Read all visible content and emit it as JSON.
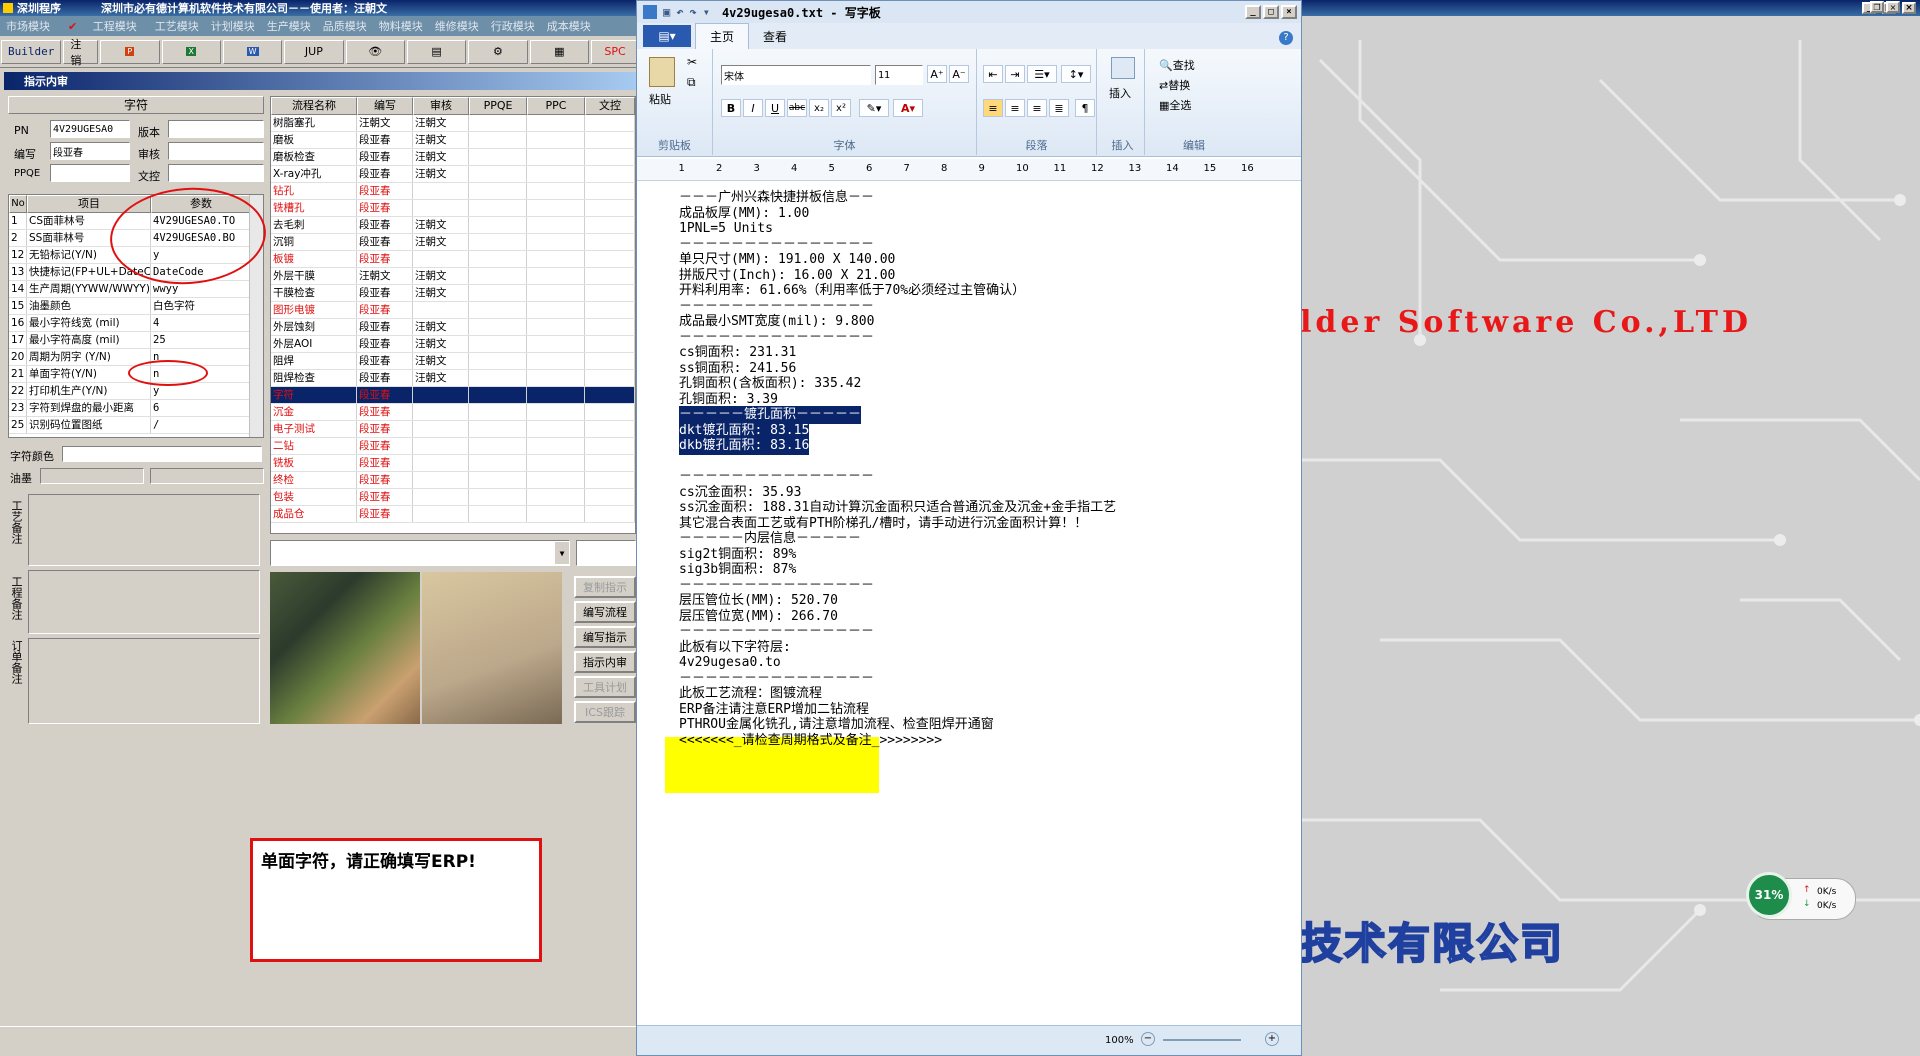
{
  "erp": {
    "title": "深圳程序",
    "company_user": "深圳市必有德计算机软件技术有限公司－－使用者：汪朝文",
    "menu": [
      "市场模块",
      "工程模块",
      "工艺模块",
      "计划模块",
      "生产模块",
      "品质模块",
      "物料模块",
      "维修模块",
      "行政模块",
      "成本模块"
    ],
    "toolbar": [
      "Builder",
      "注销",
      "",
      "",
      "",
      "JUP",
      "",
      "",
      "",
      "",
      "SPC"
    ],
    "form_title": "指示内审",
    "section_header": "字符",
    "fields": {
      "pn_label": "PN",
      "pn_value": "4V29UGESA0",
      "version_label": "版本",
      "version_value": "",
      "author_label": "编写",
      "author_value": "段亚春",
      "review_label": "审核",
      "review_value": "",
      "ppqe_label": "PPQE",
      "ppqe_value": "",
      "control_label": "文控",
      "control_value": ""
    },
    "params_headers": [
      "No",
      "项目",
      "参数"
    ],
    "params": [
      {
        "no": "1",
        "item": "CS面菲林号",
        "value": "4V29UGESA0.TO"
      },
      {
        "no": "2",
        "item": "SS面菲林号",
        "value": "4V29UGESA0.BO"
      },
      {
        "no": "12",
        "item": "无铅标记(Y/N)",
        "value": "y"
      },
      {
        "no": "13",
        "item": "快捷标记(FP+UL+DateCo",
        "value": "DateCode"
      },
      {
        "no": "14",
        "item": "生产周期(YYWW/WWYY)",
        "value": "wwyy"
      },
      {
        "no": "15",
        "item": "油墨颜色",
        "value": "白色字符"
      },
      {
        "no": "16",
        "item": "最小字符线宽 (mil)",
        "value": "4"
      },
      {
        "no": "17",
        "item": "最小字符高度 (mil)",
        "value": "25"
      },
      {
        "no": "20",
        "item": "周期为阴字 (Y/N)",
        "value": "n"
      },
      {
        "no": "21",
        "item": "单面字符(Y/N)",
        "value": "n"
      },
      {
        "no": "22",
        "item": "打印机生产(Y/N)",
        "value": "y"
      },
      {
        "no": "23",
        "item": "字符到焊盘的最小距离",
        "value": "6"
      },
      {
        "no": "25",
        "item": "识别码位置图纸",
        "value": "/"
      }
    ],
    "char_color_label": "字符颜色",
    "ink_label": "油墨",
    "side_labels": [
      "工艺备注",
      "工程备注",
      "订单备注"
    ],
    "flow_headers": [
      "流程名称",
      "编写",
      "审核",
      "PPQE",
      "PPC",
      "文控"
    ],
    "flow": [
      {
        "name": "树脂塞孔",
        "author": "汪朝文",
        "reviewer": "汪朝文",
        "red": false
      },
      {
        "name": "磨板",
        "author": "段亚春",
        "reviewer": "汪朝文",
        "red": false
      },
      {
        "name": "磨板检查",
        "author": "段亚春",
        "reviewer": "汪朝文",
        "red": false
      },
      {
        "name": "X-ray冲孔",
        "author": "段亚春",
        "reviewer": "汪朝文",
        "red": false
      },
      {
        "name": "钻孔",
        "author": "段亚春",
        "reviewer": "",
        "red": true
      },
      {
        "name": "铣槽孔",
        "author": "段亚春",
        "reviewer": "",
        "red": true
      },
      {
        "name": "去毛刺",
        "author": "段亚春",
        "reviewer": "汪朝文",
        "red": false
      },
      {
        "name": "沉铜",
        "author": "段亚春",
        "reviewer": "汪朝文",
        "red": false
      },
      {
        "name": "板镀",
        "author": "段亚春",
        "reviewer": "",
        "red": true
      },
      {
        "name": "外层干膜",
        "author": "汪朝文",
        "reviewer": "汪朝文",
        "red": false
      },
      {
        "name": "干膜检查",
        "author": "段亚春",
        "reviewer": "汪朝文",
        "red": false
      },
      {
        "name": "图形电镀",
        "author": "段亚春",
        "reviewer": "",
        "red": true
      },
      {
        "name": "外层蚀刻",
        "author": "段亚春",
        "reviewer": "汪朝文",
        "red": false
      },
      {
        "name": "外层AOI",
        "author": "段亚春",
        "reviewer": "汪朝文",
        "red": false
      },
      {
        "name": "阻焊",
        "author": "段亚春",
        "reviewer": "汪朝文",
        "red": false
      },
      {
        "name": "阻焊检查",
        "author": "段亚春",
        "reviewer": "汪朝文",
        "red": false
      },
      {
        "name": "字符",
        "author": "段亚春",
        "reviewer": "",
        "red": true,
        "selected": true
      },
      {
        "name": "沉金",
        "author": "段亚春",
        "reviewer": "",
        "red": true
      },
      {
        "name": "电子测试",
        "author": "段亚春",
        "reviewer": "",
        "red": true
      },
      {
        "name": "二钻",
        "author": "段亚春",
        "reviewer": "",
        "red": true
      },
      {
        "name": "铣板",
        "author": "段亚春",
        "reviewer": "",
        "red": true
      },
      {
        "name": "终检",
        "author": "段亚春",
        "reviewer": "",
        "red": true
      },
      {
        "name": "包装",
        "author": "段亚春",
        "reviewer": "",
        "red": true
      },
      {
        "name": "成品仓",
        "author": "段亚春",
        "reviewer": "",
        "red": true
      }
    ],
    "buttons": {
      "copy": "复制指示",
      "edit_flow": "编写流程",
      "edit_instr": "编写指示",
      "audit": "指示内审",
      "eng_plan": "工具计划",
      "ics": "ICS跟踪"
    },
    "warning": "单面字符，请正确填写ERP!"
  },
  "wordpad": {
    "title": "4v29ugesa0.txt - 写字板",
    "tabs": [
      "主页",
      "查看"
    ],
    "font_name": "宋体",
    "font_size": "11",
    "groups": [
      "剪贴板",
      "字体",
      "段落",
      "插入",
      "编辑"
    ],
    "paste": "粘贴",
    "insert": "插入",
    "edit_items": [
      "查找",
      "替换",
      "全选"
    ],
    "zoom": "100%",
    "lines": [
      "－－－广州兴森快捷拼板信息－－",
      "成品板厚(MM): 1.00",
      "1PNL=5 Units",
      "－－－－－－－－－－－－－－－",
      "单只尺寸(MM): 191.00 X 140.00",
      "拼版尺寸(Inch): 16.00 X 21.00",
      "开料利用率: 61.66%（利用率低于70%必须经过主管确认）",
      "－－－－－－－－－－－－－－－",
      "成品最小SMT宽度(mil): 9.800",
      "－－－－－－－－－－－－－－－",
      "cs铜面积: 231.31",
      "ss铜面积: 241.56",
      "孔铜面积(含板面积): 335.42",
      "孔铜面积: 3.39",
      "－－－－－镀孔面积－－－－－",
      "dkt镀孔面积: 83.15",
      "dkb镀孔面积: 83.16",
      "",
      "－－－－－－－－－－－－－－－",
      "cs沉金面积: 35.93",
      "ss沉金面积: 188.31自动计算沉金面积只适合普通沉金及沉金+金手指工艺",
      "其它混合表面工艺或有PTH阶梯孔/槽时，请手动进行沉金面积计算！！",
      "－－－－－内层信息－－－－－",
      "sig2t铜面积: 89%",
      "sig3b铜面积: 87%",
      "－－－－－－－－－－－－－－－",
      "层压管位长(MM): 520.70",
      "层压管位宽(MM): 266.70",
      "－－－－－－－－－－－－－－－",
      "此板有以下字符层:",
      "4v29ugesa0.to",
      "－－－－－－－－－－－－－－－",
      "此板工艺流程：图镀流程",
      "ERP备注请注意ERP增加二钻流程",
      "PTHROU金属化铣孔,请注意增加流程、检查阻焊开通窗",
      "<<<<<<<_请检查周期格式及备注_>>>>>>>>"
    ]
  },
  "background": {
    "company_en": "lder Software Co.,LTD",
    "company_cn": "技术有限公司"
  },
  "net_widget": {
    "percent": "31%",
    "up": "0K/s",
    "down": "0K/s"
  }
}
